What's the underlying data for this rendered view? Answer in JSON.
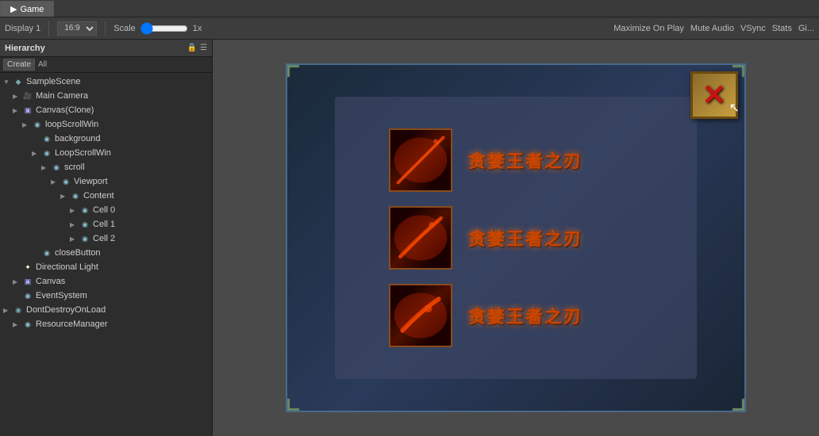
{
  "tabs": [
    {
      "label": "Game",
      "icon": "▶",
      "active": true
    }
  ],
  "toolbar": {
    "display_label": "Display 1",
    "aspect_label": "16:9",
    "scale_label": "Scale",
    "scale_value": "1x",
    "maximize_on_play": "Maximize On Play",
    "mute_audio": "Mute Audio",
    "vsync": "VSync",
    "stats": "Stats",
    "gizmos": "Gi..."
  },
  "hierarchy": {
    "title": "Hierarchy",
    "create_label": "Create",
    "all_label": "All",
    "scene": "SampleScene",
    "items": [
      {
        "label": "Main Camera",
        "indent": 1,
        "type": "camera",
        "arrow": "▶"
      },
      {
        "label": "Canvas(Clone)",
        "indent": 1,
        "type": "canvas",
        "arrow": "▶"
      },
      {
        "label": "loopScrollWin",
        "indent": 2,
        "type": "obj",
        "arrow": "▶"
      },
      {
        "label": "background",
        "indent": 3,
        "type": "obj",
        "arrow": ""
      },
      {
        "label": "LoopScrollWin",
        "indent": 3,
        "type": "obj",
        "arrow": "▶"
      },
      {
        "label": "scroll",
        "indent": 4,
        "type": "obj",
        "arrow": "▶"
      },
      {
        "label": "Viewport",
        "indent": 5,
        "type": "obj",
        "arrow": "▶"
      },
      {
        "label": "Content",
        "indent": 6,
        "type": "obj",
        "arrow": "▶"
      },
      {
        "label": "Cell 0",
        "indent": 7,
        "type": "obj",
        "arrow": "▶"
      },
      {
        "label": "Cell 1",
        "indent": 7,
        "type": "obj",
        "arrow": "▶"
      },
      {
        "label": "Cell 2",
        "indent": 7,
        "type": "obj",
        "arrow": "▶"
      },
      {
        "label": "closeButton",
        "indent": 3,
        "type": "obj",
        "arrow": ""
      },
      {
        "label": "Directional Light",
        "indent": 1,
        "type": "light",
        "arrow": ""
      },
      {
        "label": "Canvas",
        "indent": 1,
        "type": "canvas",
        "arrow": "▶"
      },
      {
        "label": "EventSystem",
        "indent": 1,
        "type": "obj",
        "arrow": ""
      },
      {
        "label": "DontDestroyOnLoad",
        "indent": 0,
        "type": "scene",
        "arrow": "▶"
      },
      {
        "label": "ResourceManager",
        "indent": 1,
        "type": "obj",
        "arrow": "▶"
      }
    ]
  },
  "game": {
    "items": [
      {
        "name": "贪婪王者之刃"
      },
      {
        "name": "贪婪王者之刃"
      },
      {
        "name": "贪婪王者之刃"
      }
    ],
    "close_label": "✕"
  }
}
